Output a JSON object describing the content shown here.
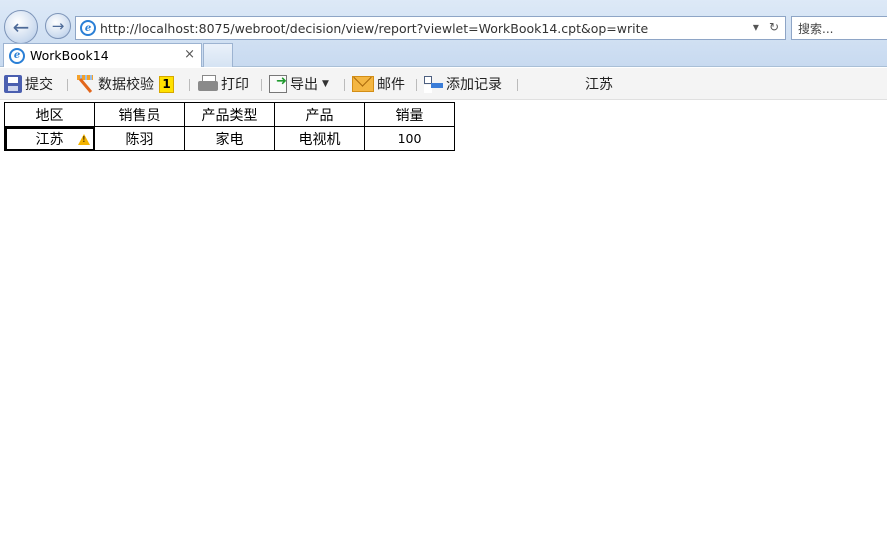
{
  "browser": {
    "url": "http://localhost:8075/webroot/decision/view/report?viewlet=WorkBook14.cpt&op=write",
    "search_placeholder": "搜索...",
    "tab_title": "WorkBook14",
    "tab_close": "×",
    "refresh_icon": "refresh-icon",
    "back_icon": "back-arrow-icon",
    "forward_icon": "forward-arrow-icon"
  },
  "toolbar": {
    "submit_label": "提交",
    "validate_label": "数据校验",
    "validate_count": "1",
    "print_label": "打印",
    "export_label": "导出",
    "email_label": "邮件",
    "add_record_label": "添加记录",
    "region_value": "江苏"
  },
  "table": {
    "headers": [
      "地区",
      "销售员",
      "产品类型",
      "产品",
      "销量"
    ],
    "row": [
      "江苏",
      "陈羽",
      "家电",
      "电视机",
      "100"
    ]
  },
  "colors": {
    "badge": "#ffe100",
    "warning": "#f4b400",
    "chrome": "#dde9f7"
  }
}
